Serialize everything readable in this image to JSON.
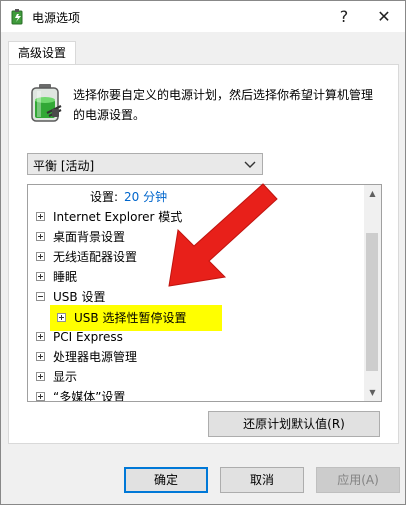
{
  "window": {
    "title": "电源选项",
    "help_glyph": "?",
    "close_glyph": "✕"
  },
  "tab": {
    "label": "高级设置"
  },
  "description": "选择你要自定义的电源计划，然后选择你希望计算机管理的电源设置。",
  "plan_select": {
    "value": "平衡 [活动]"
  },
  "tree": {
    "setting_prefix": "设置:",
    "setting_value": "20 分钟",
    "items": [
      {
        "label": "Internet Explorer 模式"
      },
      {
        "label": "桌面背景设置"
      },
      {
        "label": "无线适配器设置"
      },
      {
        "label": "睡眠"
      },
      {
        "label": "USB 设置"
      },
      {
        "label": "USB 选择性暂停设置"
      },
      {
        "label": "PCI Express"
      },
      {
        "label": "处理器电源管理"
      },
      {
        "label": "显示"
      },
      {
        "label": "“多媒体”设置"
      }
    ]
  },
  "buttons": {
    "restore_defaults": "还原计划默认值(R)",
    "ok": "确定",
    "cancel": "取消",
    "apply": "应用(A)"
  },
  "colors": {
    "highlight": "#ffff00",
    "arrow": "#e8201a",
    "link_blue": "#0066cc",
    "accent": "#0078d7"
  }
}
